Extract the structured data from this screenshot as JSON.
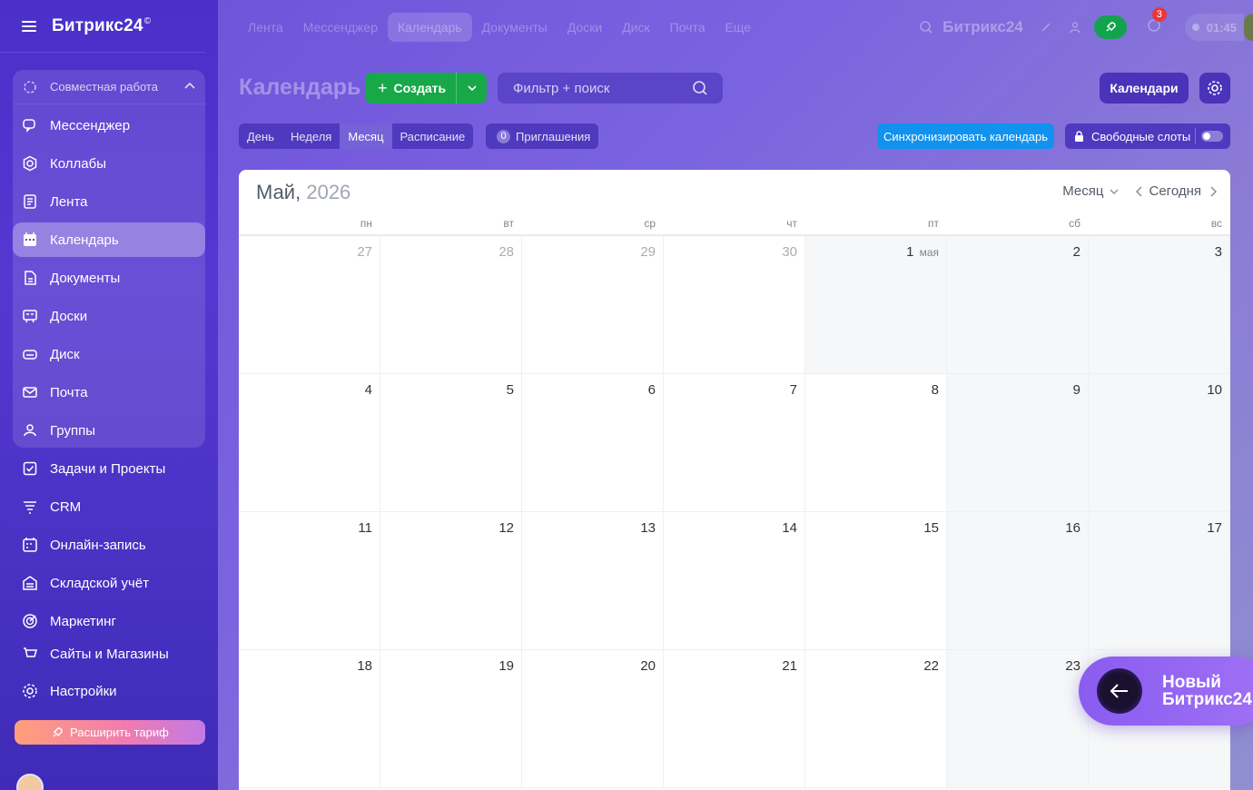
{
  "sidebar": {
    "logo": "Битрикс24",
    "logo_mark": "©",
    "group_title": "Совместная работа",
    "items": [
      {
        "label": "Мессенджер",
        "icon": "chat-icon"
      },
      {
        "label": "Коллабы",
        "icon": "hexagon-icon"
      },
      {
        "label": "Лента",
        "icon": "feed-icon"
      },
      {
        "label": "Календарь",
        "icon": "calendar-icon",
        "active": true
      },
      {
        "label": "Документы",
        "icon": "document-icon"
      },
      {
        "label": "Доски",
        "icon": "board-icon"
      },
      {
        "label": "Диск",
        "icon": "disk-icon"
      },
      {
        "label": "Почта",
        "icon": "mail-icon"
      },
      {
        "label": "Группы",
        "icon": "groups-icon"
      },
      {
        "label": "Задачи и Проекты",
        "icon": "task-icon"
      },
      {
        "label": "CRM",
        "icon": "crm-icon"
      },
      {
        "label": "Онлайн-запись",
        "icon": "booking-icon"
      },
      {
        "label": "Складской учёт",
        "icon": "warehouse-icon"
      },
      {
        "label": "Маркетинг",
        "icon": "target-icon"
      },
      {
        "label": "Сайты и Магазины",
        "icon": "shop-icon"
      },
      {
        "label": "Настройки",
        "icon": "gear-icon"
      }
    ],
    "upgrade_label": "Расширить тариф"
  },
  "topbar": {
    "nav": [
      "Лента",
      "Мессенджер",
      "Календарь",
      "Документы",
      "Доски",
      "Диск",
      "Почта",
      "Еще"
    ],
    "active_nav": "Календарь",
    "brand": "Битрикс24",
    "notifications": "3",
    "time": "01:45"
  },
  "toolbar": {
    "title": "Календарь",
    "create_label": "Создать",
    "search_placeholder": "Фильтр + поиск",
    "calendars_label": "Календари",
    "views": [
      "День",
      "Неделя",
      "Месяц",
      "Расписание"
    ],
    "active_view": "Месяц",
    "invites_count": "0",
    "invites_label": "Приглашения",
    "sync_label": "Синхронизировать календарь",
    "slots_label": "Свободные слоты"
  },
  "calendar": {
    "month": "Май,",
    "year": "2026",
    "mode_label": "Месяц",
    "today_label": "Сегодня",
    "weekdays": [
      "пн",
      "вт",
      "ср",
      "чт",
      "пт",
      "сб",
      "вс"
    ],
    "weeks": [
      [
        {
          "d": "27",
          "other": true
        },
        {
          "d": "28",
          "other": true
        },
        {
          "d": "29",
          "other": true
        },
        {
          "d": "30",
          "other": true
        },
        {
          "d": "1",
          "mon": "мая"
        },
        {
          "d": "2"
        },
        {
          "d": "3"
        }
      ],
      [
        {
          "d": "4"
        },
        {
          "d": "5"
        },
        {
          "d": "6"
        },
        {
          "d": "7"
        },
        {
          "d": "8"
        },
        {
          "d": "9"
        },
        {
          "d": "10"
        }
      ],
      [
        {
          "d": "11"
        },
        {
          "d": "12"
        },
        {
          "d": "13"
        },
        {
          "d": "14"
        },
        {
          "d": "15"
        },
        {
          "d": "16"
        },
        {
          "d": "17"
        }
      ],
      [
        {
          "d": "18"
        },
        {
          "d": "19"
        },
        {
          "d": "20"
        },
        {
          "d": "21"
        },
        {
          "d": "22"
        },
        {
          "d": "23"
        },
        {
          "d": ""
        }
      ]
    ]
  },
  "promo": {
    "line1": "Новый",
    "line2": "Битрикс24"
  },
  "colors": {
    "accent": "#17a848",
    "sync": "#1192ef",
    "sidebar": "#4a2fc9"
  }
}
